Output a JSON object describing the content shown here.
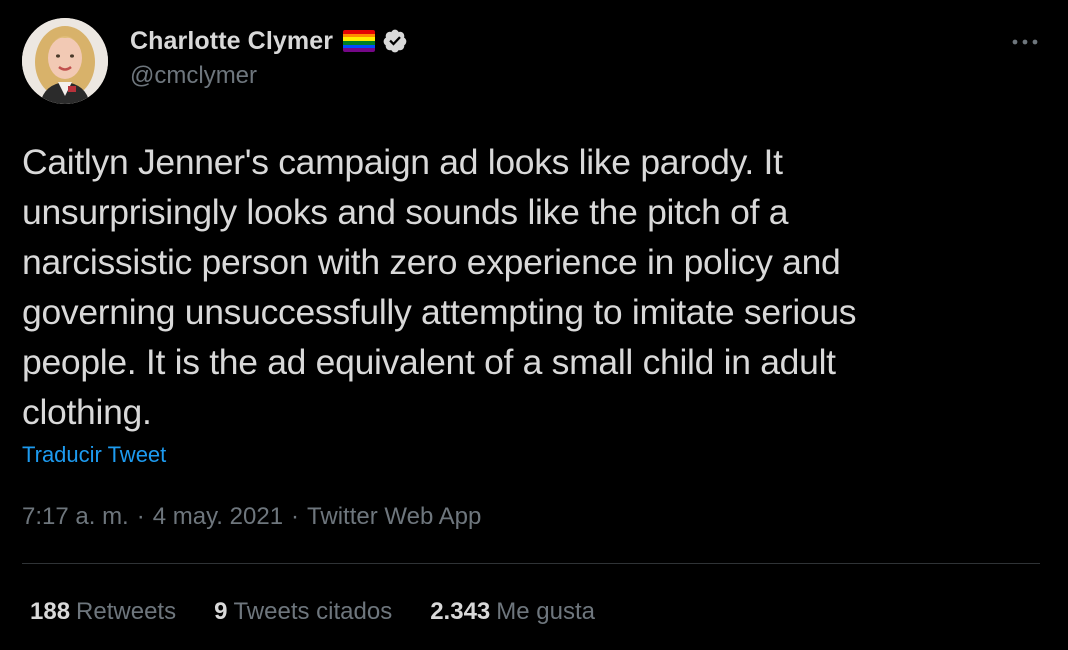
{
  "author": {
    "display_name": "Charlotte Clymer",
    "handle": "@cmclymer",
    "avatar_icon": "profile-photo",
    "flag_icon": "rainbow-flag-icon",
    "verified_icon": "verified-badge-icon",
    "more_icon": "more-options-icon"
  },
  "tweet": {
    "text": "Caitlyn Jenner's campaign ad looks like parody. It unsurprisingly looks and sounds like the pitch of a narcissistic person with zero experience in policy and governing unsuccessfully attempting to imitate serious people. It is the ad equivalent of a small child in adult clothing.",
    "lines": [
      "Caitlyn Jenner's campaign ad looks like parody. It",
      "unsurprisingly looks and sounds like the pitch of a",
      "narcissistic person with zero experience in policy and",
      "governing unsuccessfully attempting to imitate serious",
      "people. It is the ad equivalent of a small child in adult",
      "clothing."
    ],
    "translate_label": "Traducir Tweet"
  },
  "meta": {
    "time": "7:17 a. m.",
    "sep1": "·",
    "date": "4 may. 2021",
    "sep2": "·",
    "source": "Twitter Web App"
  },
  "stats": {
    "retweets": {
      "count": "188",
      "label": "Retweets"
    },
    "quotes": {
      "count": "9",
      "label": "Tweets citados"
    },
    "likes": {
      "count": "2.343",
      "label": "Me gusta"
    }
  },
  "colors": {
    "background": "#000000",
    "text": "#d9d9d9",
    "secondary": "#6e767d",
    "link": "#1d9bf0",
    "divider": "#2f3336"
  }
}
